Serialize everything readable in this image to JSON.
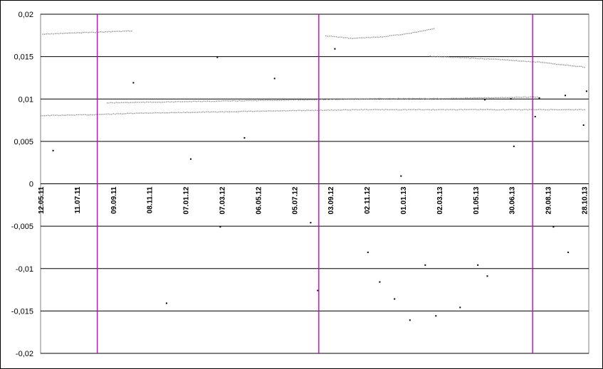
{
  "chart_data": {
    "type": "scatter",
    "title": "",
    "xlabel": "",
    "ylabel": "",
    "ylim": [
      -0.02,
      0.02
    ],
    "y_ticks": [
      "0,02",
      "0,015",
      "0,01",
      "0,005",
      "0",
      "-0,005",
      "-0,01",
      "-0,015",
      "-0,02"
    ],
    "y_tick_values": [
      0.02,
      0.015,
      0.01,
      0.005,
      0,
      -0.005,
      -0.01,
      -0.015,
      -0.02
    ],
    "x_tick_labels": [
      "12.05.11",
      "11.07.11",
      "09.09.11",
      "08.11.11",
      "07.01.12",
      "07.03.12",
      "06.05.12",
      "05.07.12",
      "03.09.12",
      "02.11.12",
      "01.01.13",
      "02.03.13",
      "01.05.13",
      "30.06.13",
      "29.08.13",
      "28.10.13"
    ],
    "xlim": [
      "2011-05-12",
      "2013-11-25"
    ],
    "grid": "horizontal",
    "legend": "none",
    "vertical_markers": [
      "2011-08-16",
      "2012-08-25",
      "2013-08-22"
    ],
    "colors": {
      "marker_line": "#cc00cc",
      "grid": "#000000",
      "dark_points": "#000000",
      "light_points": "#8c8c8c"
    },
    "series": [
      {
        "color": "#8c8c8c",
        "points": [
          [
            "2011-05-12",
            0.0081
          ],
          [
            "2011-08-01",
            0.0082
          ],
          [
            "2011-11-01",
            0.0084
          ],
          [
            "2012-02-01",
            0.0085
          ],
          [
            "2012-05-01",
            0.0086
          ],
          [
            "2012-08-01",
            0.0087
          ],
          [
            "2012-11-01",
            0.0088
          ],
          [
            "2013-02-01",
            0.0088
          ],
          [
            "2013-05-01",
            0.0088
          ],
          [
            "2013-08-01",
            0.0088
          ],
          [
            "2013-11-20",
            0.0088
          ]
        ]
      },
      {
        "color": "#8c8c8c",
        "points": [
          [
            "2011-09-01",
            0.0096
          ],
          [
            "2011-12-01",
            0.0097
          ],
          [
            "2012-03-01",
            0.0098
          ],
          [
            "2012-06-01",
            0.0099
          ],
          [
            "2012-09-01",
            0.01
          ],
          [
            "2012-12-01",
            0.0101
          ],
          [
            "2013-03-01",
            0.0101
          ],
          [
            "2013-06-01",
            0.0102
          ],
          [
            "2013-09-01",
            0.0103
          ]
        ]
      },
      {
        "color": "#8c8c8c",
        "points": [
          [
            "2011-05-15",
            0.0177
          ],
          [
            "2011-06-20",
            0.0178
          ],
          [
            "2011-07-25",
            0.0179
          ],
          [
            "2011-09-10",
            0.018
          ],
          [
            "2011-10-15",
            0.0181
          ]
        ]
      },
      {
        "color": "#8c8c8c",
        "points": [
          [
            "2012-09-05",
            0.0175
          ],
          [
            "2012-10-20",
            0.0172
          ],
          [
            "2012-12-10",
            0.0174
          ],
          [
            "2013-01-25",
            0.0178
          ],
          [
            "2013-03-10",
            0.0184
          ]
        ]
      },
      {
        "color": "#8c8c8c",
        "points": [
          [
            "2013-03-01",
            0.0151
          ],
          [
            "2013-05-01",
            0.0149
          ],
          [
            "2013-07-01",
            0.0147
          ],
          [
            "2013-09-01",
            0.0144
          ],
          [
            "2013-11-20",
            0.0138
          ]
        ]
      },
      {
        "color": "#000000",
        "points": [
          [
            "2013-06-01",
            0.01
          ],
          [
            "2013-07-15",
            0.0101
          ],
          [
            "2013-09-01",
            0.0102
          ],
          [
            "2013-10-15",
            0.0105
          ],
          [
            "2013-11-20",
            0.011
          ]
        ]
      },
      {
        "color": "#000000",
        "points": [
          [
            "2011-06-01",
            0.004
          ],
          [
            "2011-07-10",
            -0.0005
          ],
          [
            "2011-10-15",
            0.012
          ],
          [
            "2012-01-20",
            0.003
          ],
          [
            "2012-03-05",
            0.015
          ],
          [
            "2012-04-20",
            0.0055
          ],
          [
            "2012-06-10",
            0.0125
          ],
          [
            "2012-08-10",
            -0.0045
          ],
          [
            "2012-08-22",
            -0.0125
          ],
          [
            "2012-09-20",
            0.016
          ],
          [
            "2012-11-15",
            -0.008
          ],
          [
            "2012-12-05",
            -0.0115
          ],
          [
            "2012-12-30",
            -0.0135
          ],
          [
            "2013-01-10",
            0.001
          ],
          [
            "2013-01-25",
            -0.016
          ],
          [
            "2013-02-20",
            -0.0095
          ],
          [
            "2013-03-10",
            -0.0155
          ],
          [
            "2013-04-20",
            -0.0145
          ],
          [
            "2013-05-20",
            -0.0095
          ],
          [
            "2013-06-05",
            -0.0108
          ],
          [
            "2013-07-20",
            0.0045
          ],
          [
            "2013-08-25",
            0.008
          ],
          [
            "2013-09-25",
            -0.005
          ],
          [
            "2013-10-20",
            -0.008
          ],
          [
            "2013-11-15",
            0.007
          ],
          [
            "2012-03-10",
            -0.005
          ],
          [
            "2011-12-10",
            -0.014
          ]
        ]
      }
    ]
  }
}
